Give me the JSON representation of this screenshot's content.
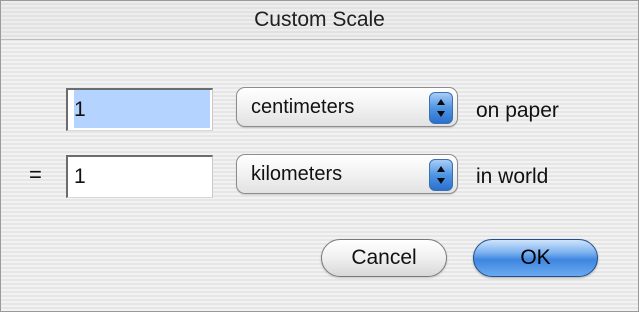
{
  "dialog": {
    "title": "Custom Scale"
  },
  "paper_row": {
    "value": "1",
    "unit_selected": "centimeters",
    "suffix": "on paper"
  },
  "world_row": {
    "prefix": "=",
    "value": "1",
    "unit_selected": "kilometers",
    "suffix": "in world"
  },
  "buttons": {
    "cancel_label": "Cancel",
    "ok_label": "OK"
  },
  "colors": {
    "selection": "#b5d3ff",
    "default_button": "#3f86e0",
    "popup_arrows": "#4f95e3"
  },
  "icons": {
    "popup_arrows": "up-down-chevron-icon"
  }
}
